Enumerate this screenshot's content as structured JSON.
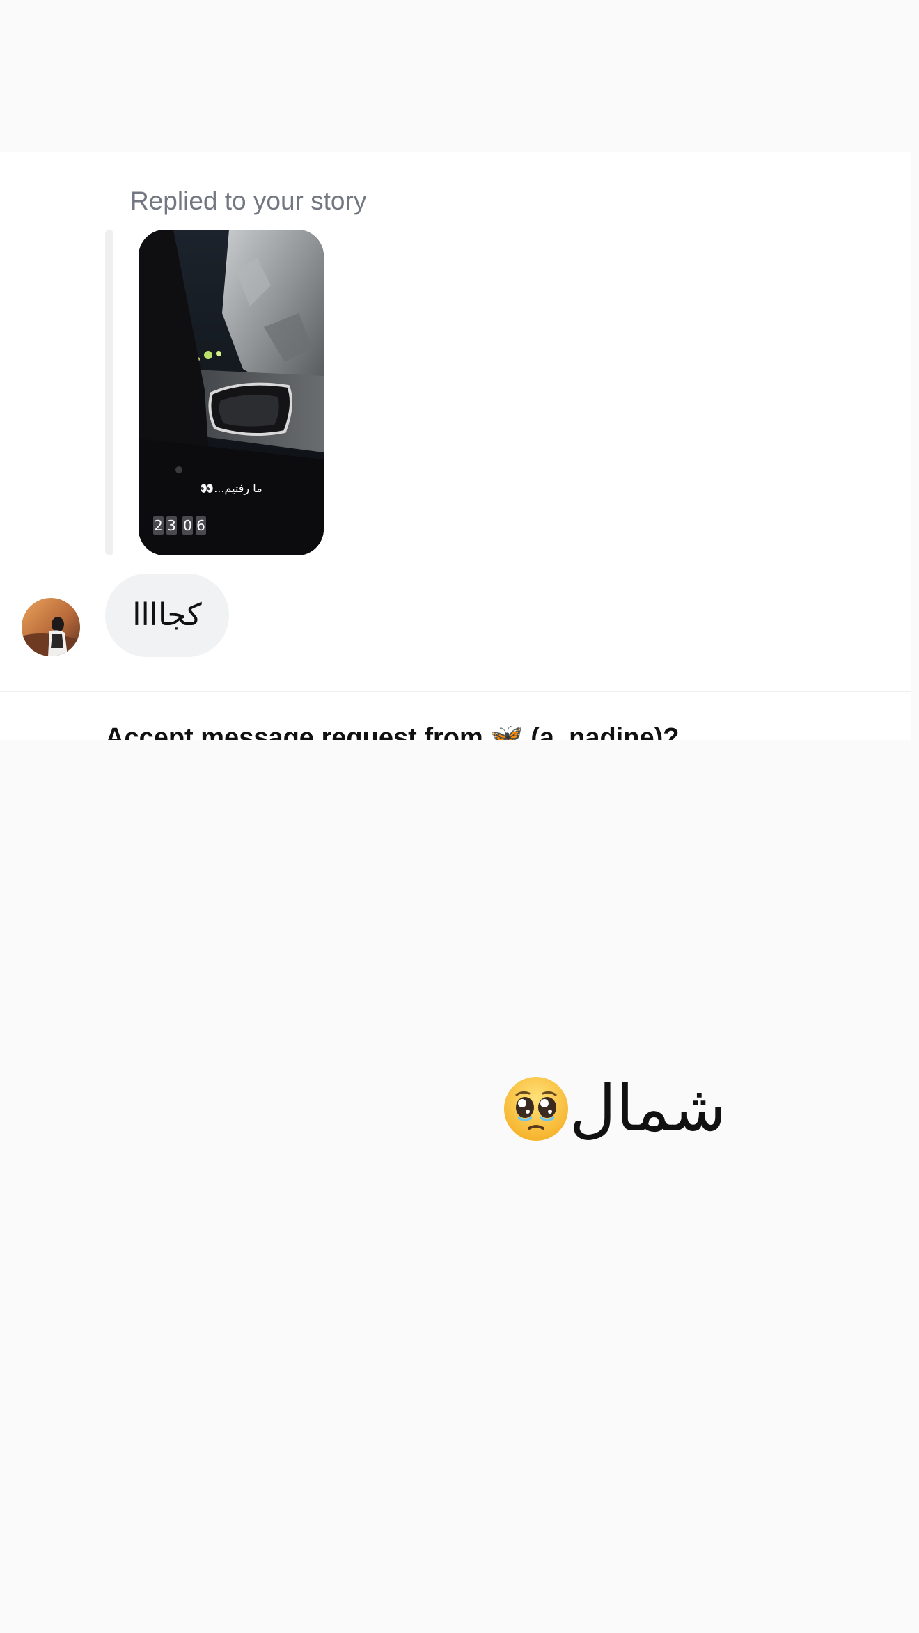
{
  "story_reply": {
    "label": "Replied to your story",
    "story_caption": "ما رفتیم...👀",
    "story_clock": [
      "2",
      "3",
      "0",
      "6"
    ]
  },
  "message": {
    "text": "کجاااا"
  },
  "request": {
    "text": "Accept message request from 🦋 (a_nadine)?"
  },
  "preview": {
    "text": "شمال",
    "emoji": "pleading-face-icon"
  },
  "colors": {
    "page_background": "#fafafa",
    "card_background": "#ffffff",
    "bubble_background": "#f1f2f4",
    "muted_text": "#737782",
    "primary_text": "#111111"
  }
}
